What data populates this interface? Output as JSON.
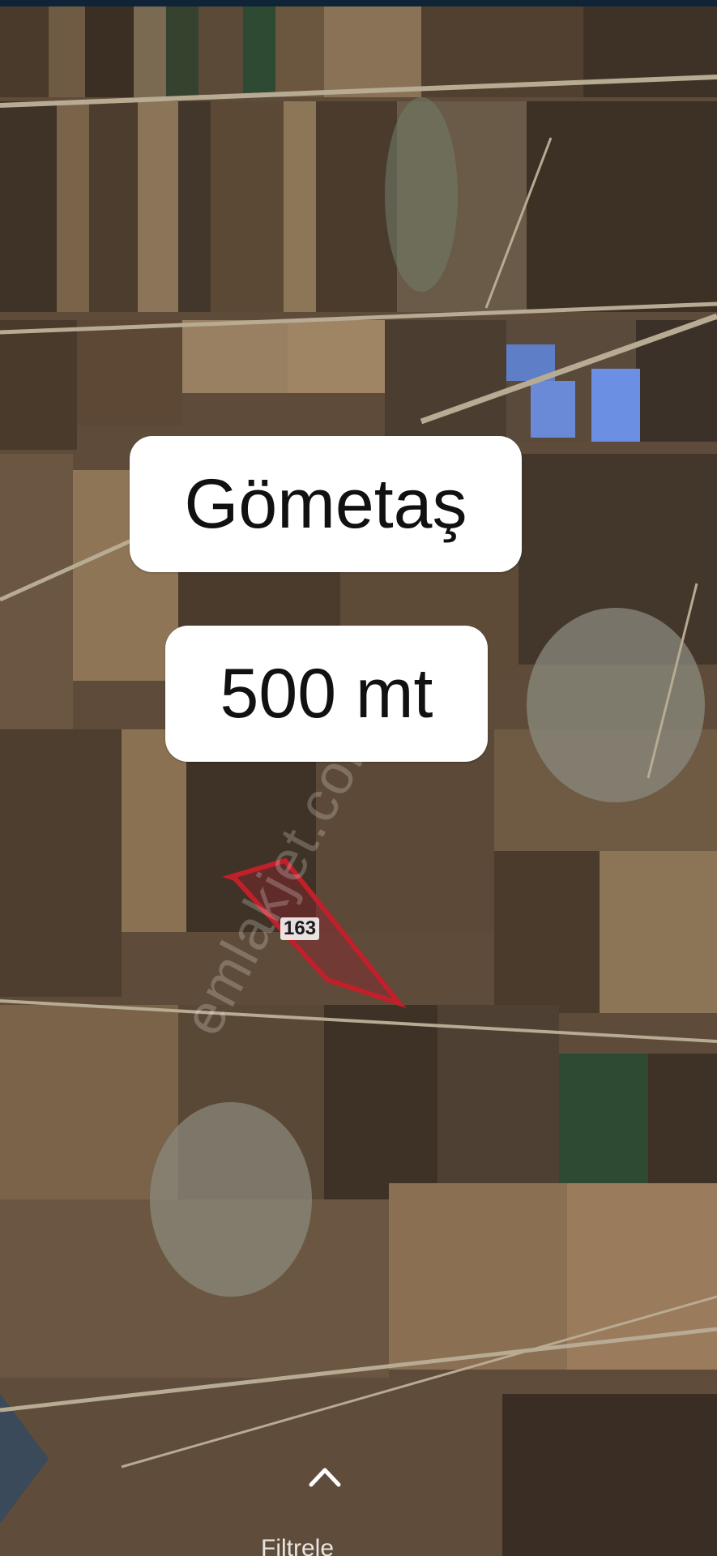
{
  "map": {
    "place_label": "Gömetaş",
    "distance_label": "500 mt",
    "parcel_number": "163",
    "watermark": "emlakjet.com",
    "bottom_text": "Filtrele",
    "parcel_color": "#c0202a",
    "map_type": "satellite"
  },
  "icons": {
    "expand_chevron": "chevron-up-icon"
  }
}
